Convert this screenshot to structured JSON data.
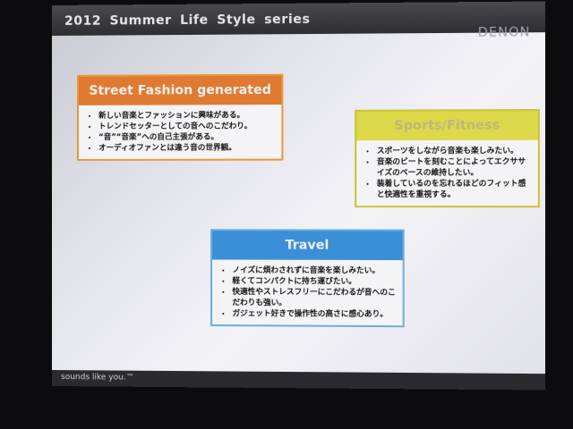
{
  "slide": {
    "title": "2012  Summer  Life Style series",
    "logo": "DENON",
    "tagline": "sounds like you.™",
    "boxes": [
      {
        "heading": "Street Fashion generated",
        "color": "#e07a30",
        "items": [
          "新しい音楽とファッションに興味がある。",
          "トレンドセッターとしての音へのこだわり。",
          "“音”“音楽”への自己主張がある。",
          "オーディオファンとは違う音の世界観。"
        ]
      },
      {
        "heading": "Sports/Fitness",
        "color": "#dcd84a",
        "items": [
          "スポーツをしながら音楽も楽しみたい。",
          "音楽のビートを刻むことによってエクササイズのベースの維持したい。",
          "装着しているのを忘れるほどのフィット感と快適性を重視する。"
        ]
      },
      {
        "heading": "Travel",
        "color": "#3a8fd8",
        "items": [
          "ノイズに煩わされずに音楽を楽しみたい。",
          "軽くてコンパクトに持ち運びたい。",
          "快適性やストレスフリーにこだわるが音へのこだわりも強い。",
          "ガジェット好きで操作性の高さに感心あり。"
        ]
      }
    ]
  }
}
